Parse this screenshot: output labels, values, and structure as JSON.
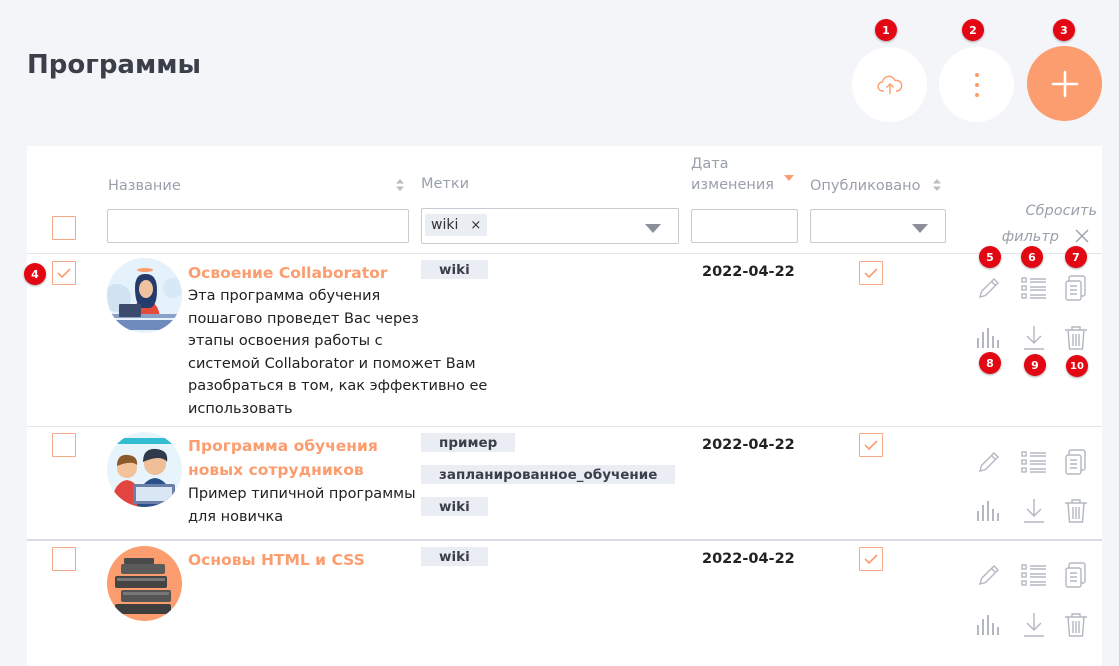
{
  "page": {
    "title": "Программы"
  },
  "colors": {
    "accent": "#fb9d6f",
    "checkbox_border": "#f4a98a",
    "marker": "#e30613",
    "tag_bg": "#ebedf4",
    "icon_gray": "#a9adb7"
  },
  "header_buttons": [
    {
      "name": "upload",
      "icon": "cloud-upload-icon"
    },
    {
      "name": "more",
      "icon": "vertical-dots-icon"
    },
    {
      "name": "add",
      "icon": "plus-icon"
    }
  ],
  "markers": [
    "1",
    "2",
    "3",
    "4",
    "5",
    "6",
    "7",
    "8",
    "9",
    "10"
  ],
  "table": {
    "columns": {
      "name": "Название",
      "tags": "Метки",
      "date_line1": "Дата",
      "date_line2": "изменения",
      "published": "Опубликовано"
    },
    "filters": {
      "tag_chip": "wiki",
      "tag_chip_remove": "×",
      "reset_line1": "Сбросить",
      "reset_line2": "фильтр"
    },
    "rows": [
      {
        "title": "Освоение Collaborator",
        "description_lines": [
          "Эта программа обучения",
          "пошагово проведет Вас через",
          "этапы освоения работы с",
          "системой Collaborator и поможет Вам",
          "разобраться в том, как эффективно ее",
          "использовать"
        ],
        "tags": [
          "wiki"
        ],
        "date": "2022-04-22",
        "selected": true,
        "published": true
      },
      {
        "title_lines": [
          "Программа обучения",
          "новых сотрудников"
        ],
        "description_lines": [
          "Пример типичной программы",
          "для новичка"
        ],
        "tags": [
          "пример",
          "запланированное_обучение",
          "wiki"
        ],
        "date": "2022-04-22",
        "selected": false,
        "published": true
      },
      {
        "title": "Основы HTML и CSS",
        "description_lines": [],
        "tags": [
          "wiki"
        ],
        "date": "2022-04-22",
        "selected": false,
        "published": true
      }
    ],
    "row_actions": [
      "edit-icon",
      "list-icon",
      "copy-icon",
      "stats-icon",
      "download-icon",
      "trash-icon"
    ]
  }
}
